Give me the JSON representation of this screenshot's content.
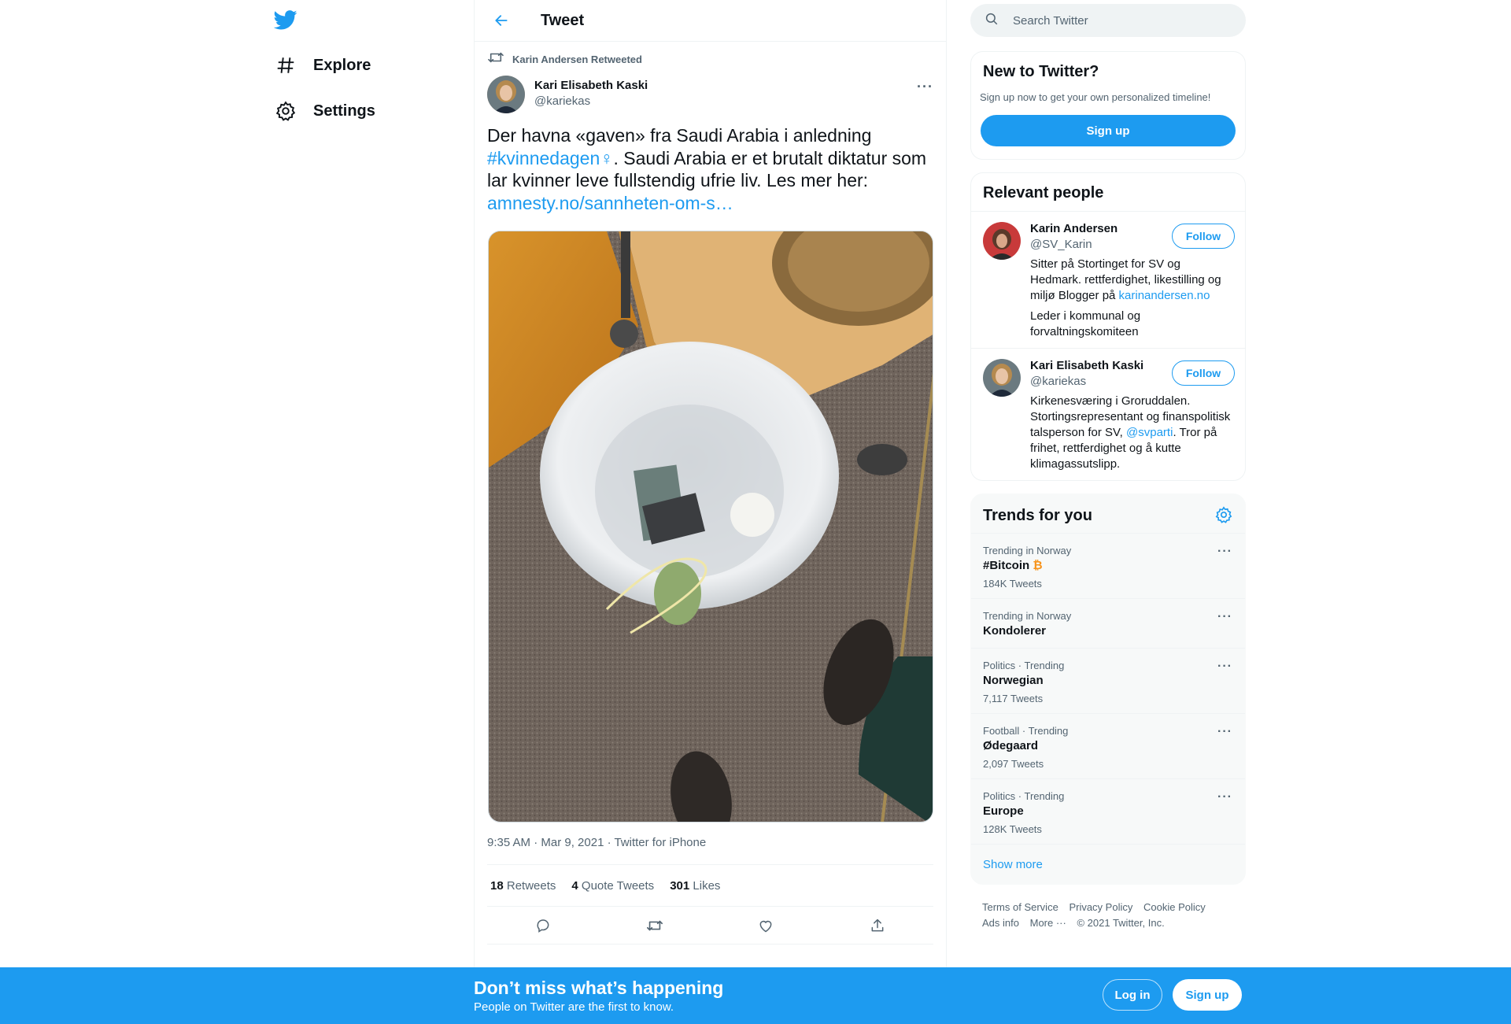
{
  "nav": {
    "items": [
      {
        "label": "Explore",
        "icon": "hashtag-icon"
      },
      {
        "label": "Settings",
        "icon": "gear-icon"
      }
    ]
  },
  "header": {
    "title": "Tweet"
  },
  "tweet": {
    "retweet_by": "Karin Andersen Retweeted",
    "author_name": "Kari Elisabeth Kaski",
    "author_handle": "@kariekas",
    "text_1": "Der havna «gaven» fra Saudi Arabia i anledning",
    "hashtag": "#kvinnedagen",
    "emoji": "♀",
    "text_2": ". Saudi Arabia er et brutalt diktatur som lar kvinner leve fullstendig ufrie liv. Les mer her:",
    "link": "amnesty.no/sannheten-om-s…",
    "timestamp": "9:35 AM · Mar 9, 2021 · Twitter for iPhone",
    "stats": {
      "retweets": "18",
      "retweets_label": "Retweets",
      "quotes": "4",
      "quotes_label": "Quote Tweets",
      "likes": "301",
      "likes_label": "Likes"
    }
  },
  "search": {
    "placeholder": "Search Twitter"
  },
  "new_to_twitter": {
    "title": "New to Twitter?",
    "subtitle": "Sign up now to get your own personalized timeline!",
    "button": "Sign up"
  },
  "relevant_people": {
    "title": "Relevant people",
    "people": [
      {
        "name": "Karin Andersen",
        "handle": "@SV_Karin",
        "follow": "Follow",
        "bio_1": "Sitter på Stortinget for SV og Hedmark. rettferdighet, likestilling og miljø Blogger på ",
        "bio_link": "karinandersen.no",
        "bio_2": "Leder i kommunal og forvaltningskomiteen"
      },
      {
        "name": "Kari Elisabeth Kaski",
        "handle": "@kariekas",
        "follow": "Follow",
        "bio_1": "Kirkenesværing i Groruddalen. Stortingsrepresentant og finanspolitisk talsperson for SV, ",
        "bio_link": "@svparti",
        "bio_2": ". Tror på frihet, rettferdighet og å kutte klimagassutslipp."
      }
    ]
  },
  "trends": {
    "title": "Trends for you",
    "items": [
      {
        "context": "Trending in Norway",
        "name": "#Bitcoin",
        "emoji": "₿",
        "count": "184K Tweets"
      },
      {
        "context": "Trending in Norway",
        "name": "Kondolerer",
        "count": ""
      },
      {
        "context": "Politics · Trending",
        "name": "Norwegian",
        "count": "7,117 Tweets"
      },
      {
        "context": "Football · Trending",
        "name": "Ødegaard",
        "count": "2,097 Tweets"
      },
      {
        "context": "Politics · Trending",
        "name": "Europe",
        "count": "128K Tweets"
      }
    ],
    "show_more": "Show more"
  },
  "footer": {
    "terms": "Terms of Service",
    "privacy": "Privacy Policy",
    "cookie": "Cookie Policy",
    "ads": "Ads info",
    "more": "More ···",
    "copyright": "© 2021 Twitter, Inc."
  },
  "bottom_bar": {
    "title": "Don’t miss what’s happening",
    "subtitle": "People on Twitter are the first to know.",
    "login": "Log in",
    "signup": "Sign up"
  },
  "colors": {
    "accent": "#1d9bf0",
    "text": "#0f1419",
    "secondary": "#536471"
  }
}
